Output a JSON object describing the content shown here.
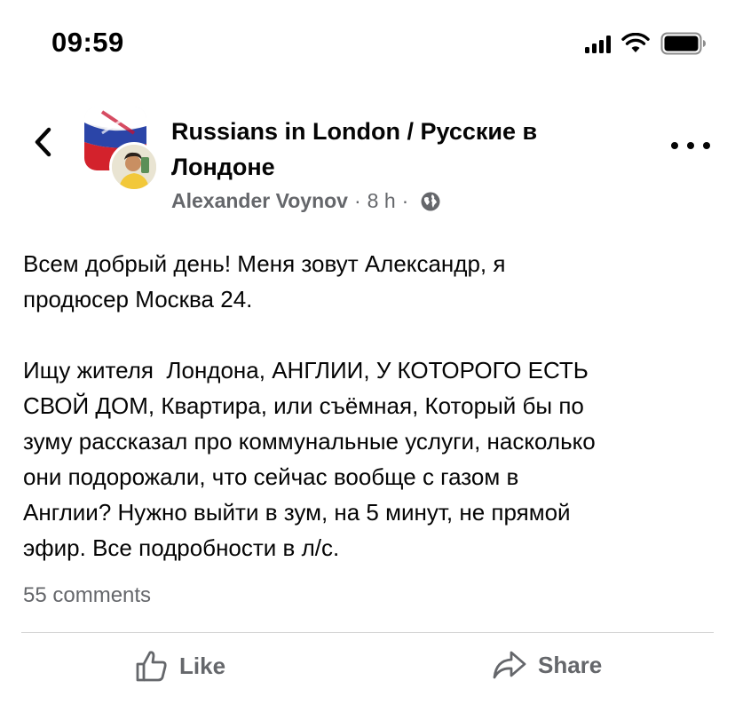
{
  "status_bar": {
    "time": "09:59",
    "icons": [
      "cellular-signal-icon",
      "wifi-icon",
      "battery-icon"
    ]
  },
  "header": {
    "back_icon": "chevron-left-icon",
    "group_name": "Russians in London / Русские в Лондоне",
    "author": "Alexander Voynov",
    "separator": "·",
    "time_ago": "8 h",
    "audience_icon": "globe-icon",
    "more_icon": "more-horizontal-icon"
  },
  "post": {
    "text": "Всем добрый день! Меня зовут Александр, я\nпродюсер Москва 24.\n\nИщу жителя  Лондона, АНГЛИИ, У КОТОРОГО ЕСТЬ\nСВОЙ ДОМ, Квартира, или съёмная, Который бы по\nзуму рассказал про коммунальные услуги, насколько\nони подорожали, что сейчас вообще с газом в\nАнглии? Нужно выйти в зум, на 5 минут, не прямой\nэфир. Все подробности в л/с.",
    "comments_count": "55 comments"
  },
  "actions": {
    "like_label": "Like",
    "like_icon": "thumbs-up-icon",
    "share_label": "Share",
    "share_icon": "share-arrow-icon"
  },
  "colors": {
    "text_primary": "#050505",
    "text_secondary": "#65676b",
    "divider": "#d4d4d4",
    "background": "#ffffff"
  }
}
